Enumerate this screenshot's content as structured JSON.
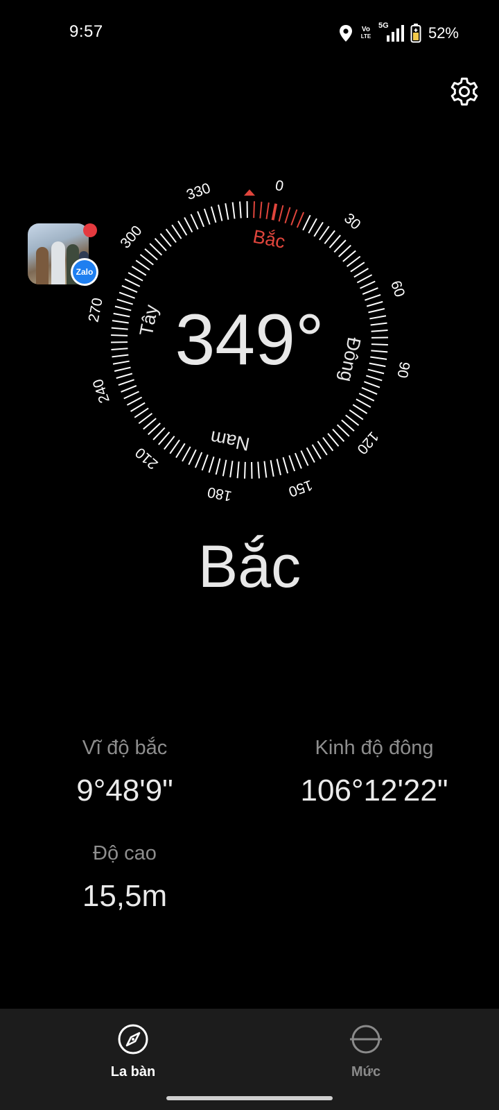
{
  "status_bar": {
    "time": "9:57",
    "network_label": "5G",
    "volte_top": "Vo",
    "volte_bottom": "LTE",
    "battery_percent": "52%",
    "icons": [
      "location-icon",
      "volte-icon",
      "signal-icon",
      "battery-icon"
    ]
  },
  "floating_bubble": {
    "app_name": "Zalo",
    "has_notification": true
  },
  "compass": {
    "heading_value": "349",
    "heading_unit": "°",
    "direction": "Bắc",
    "cardinal": {
      "north": "Bắc",
      "east": "Đông",
      "south": "Nam",
      "west": "Tây"
    },
    "degree_labels": [
      "0",
      "30",
      "60",
      "90",
      "120",
      "150",
      "180",
      "210",
      "240",
      "270",
      "300",
      "330"
    ],
    "accent_color": "#e0453c"
  },
  "location": {
    "latitude_label": "Vĩ độ bắc",
    "latitude_value": "9°48'9\"",
    "longitude_label": "Kinh độ đông",
    "longitude_value": "106°12'22\"",
    "altitude_label": "Độ cao",
    "altitude_value": "15,5m"
  },
  "bottom_nav": {
    "items": [
      {
        "label": "La bàn",
        "icon": "compass-icon",
        "active": true
      },
      {
        "label": "Mức",
        "icon": "level-icon",
        "active": false
      }
    ],
    "active_color": "#ffffff",
    "inactive_color": "#8a8a8a"
  }
}
